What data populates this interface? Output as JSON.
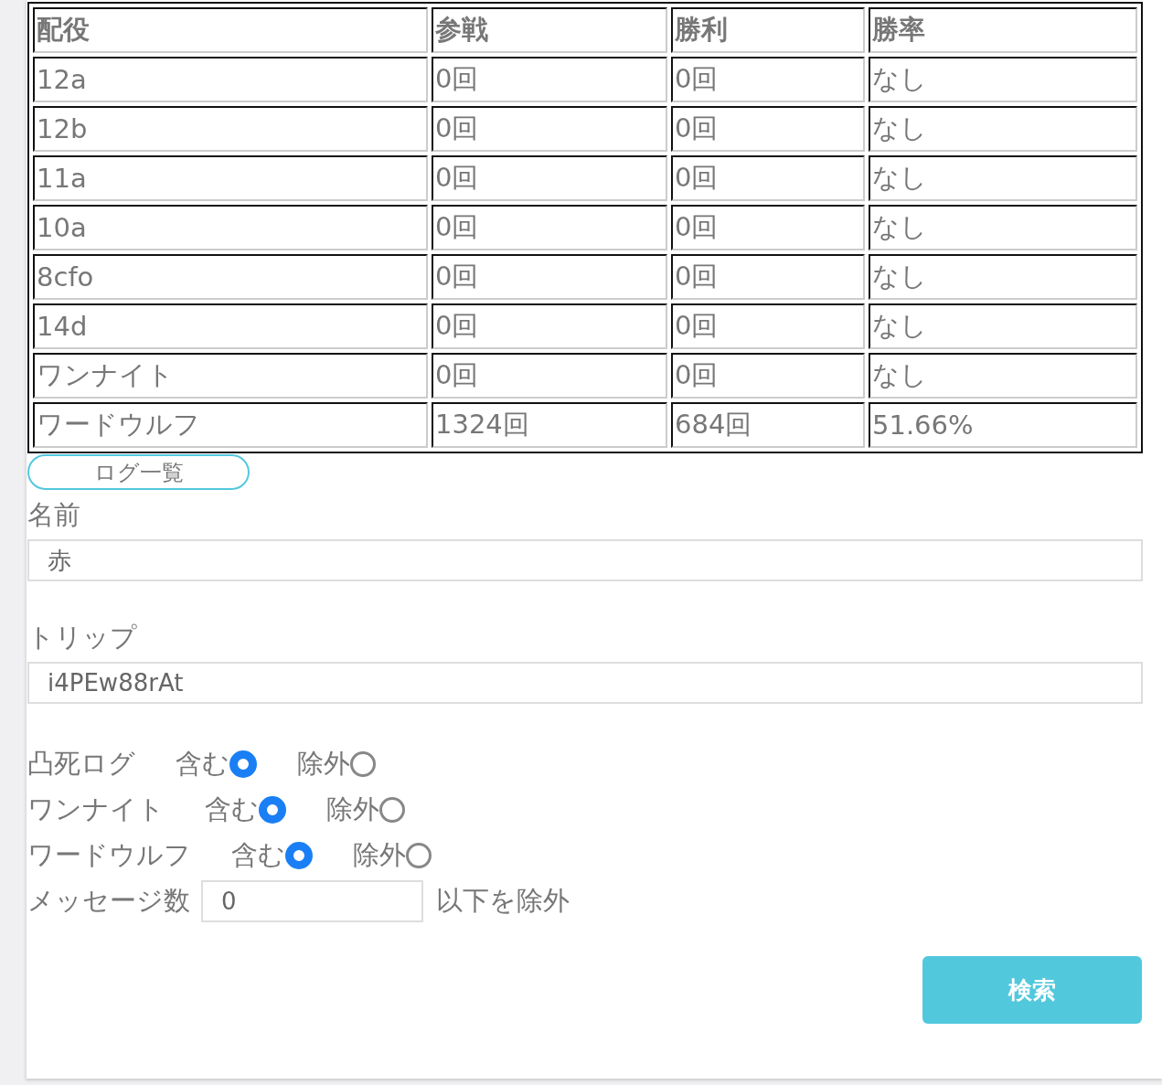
{
  "table": {
    "columns": [
      "配役",
      "参戦",
      "勝利",
      "勝率"
    ],
    "rows": [
      [
        "12a",
        "0回",
        "0回",
        "なし"
      ],
      [
        "12b",
        "0回",
        "0回",
        "なし"
      ],
      [
        "11a",
        "0回",
        "0回",
        "なし"
      ],
      [
        "10a",
        "0回",
        "0回",
        "なし"
      ],
      [
        "8cfo",
        "0回",
        "0回",
        "なし"
      ],
      [
        "14d",
        "0回",
        "0回",
        "なし"
      ],
      [
        "ワンナイト",
        "0回",
        "0回",
        "なし"
      ],
      [
        "ワードウルフ",
        "1324回",
        "684回",
        "51.66%"
      ]
    ]
  },
  "log_button": "ログ一覧",
  "name_field": {
    "label": "名前",
    "value": "赤"
  },
  "trip_field": {
    "label": "トリップ",
    "value": "i4PEw88rAt"
  },
  "filters": [
    {
      "label": "凸死ログ",
      "options": [
        {
          "label": "含む",
          "selected": true
        },
        {
          "label": "除外",
          "selected": false
        }
      ]
    },
    {
      "label": "ワンナイト",
      "options": [
        {
          "label": "含む",
          "selected": true
        },
        {
          "label": "除外",
          "selected": false
        }
      ]
    },
    {
      "label": "ワードウルフ",
      "options": [
        {
          "label": "含む",
          "selected": true
        },
        {
          "label": "除外",
          "selected": false
        }
      ]
    }
  ],
  "message_filter": {
    "label": "メッセージ数",
    "value": "0",
    "suffix": "以下を除外"
  },
  "search_button": "検索"
}
